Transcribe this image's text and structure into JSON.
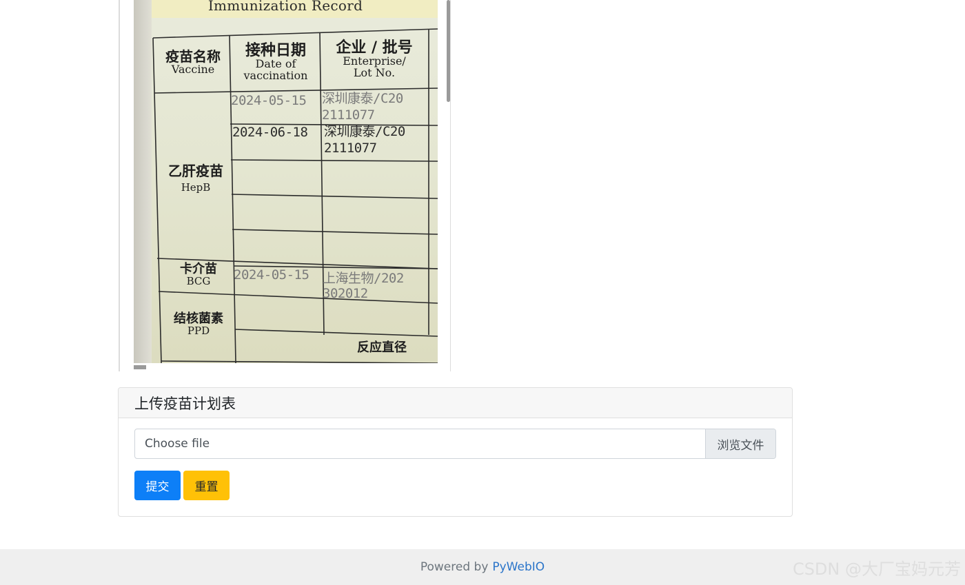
{
  "image_card": {
    "title": "Immunization Record",
    "headers": {
      "vaccine_zh": "疫苗名称",
      "vaccine_en": "Vaccine",
      "date_zh": "接种日期",
      "date_en_1": "Date of",
      "date_en_2": "vaccination",
      "enterprise_zh": "企业 / 批号",
      "enterprise_en_1": "Enterprise/",
      "enterprise_en_2": "Lot No."
    },
    "rows": [
      {
        "zh": "乙肝疫苗",
        "en": "HepB"
      },
      {
        "zh": "卡介苗",
        "en": "BCG"
      },
      {
        "zh": "结核菌素",
        "en": "PPD"
      }
    ],
    "entries": [
      {
        "date": "2024-05-15",
        "lot_1": "深圳康泰/C20",
        "lot_2": "2111077"
      },
      {
        "date": "2024-06-18",
        "lot_1": "深圳康泰/C20",
        "lot_2": "2111077"
      },
      {
        "date": "2024-05-15",
        "lot_1": "上海生物/202",
        "lot_2": "302012"
      }
    ],
    "reaction_label": "反应直径"
  },
  "upload": {
    "title": "上传疫苗计划表",
    "file_placeholder": "Choose file",
    "browse_label": "浏览文件",
    "submit_label": "提交",
    "reset_label": "重置"
  },
  "footer": {
    "powered_by": "Powered by",
    "link_text": "PyWebIO"
  },
  "watermark": "CSDN @大厂宝妈元芳",
  "colors": {
    "submit": "#0d7ff7",
    "reset": "#ffc107",
    "link": "#2a74c9",
    "footer_bg": "#efefef"
  }
}
